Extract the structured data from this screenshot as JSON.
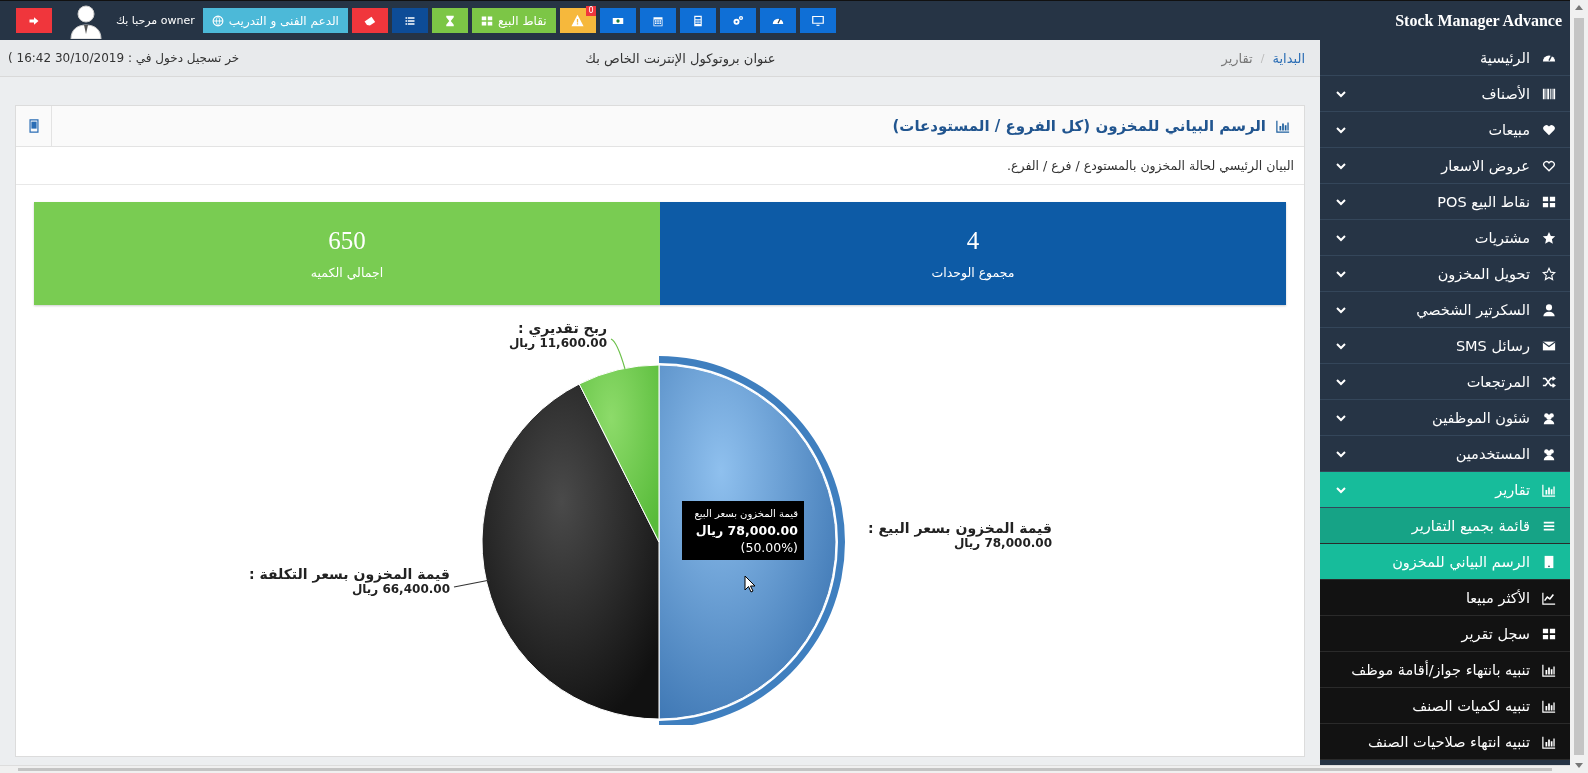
{
  "topbar": {
    "title": "Stock Manager Advance",
    "greeting": "مرحبا بك owner",
    "support_button": "الدعم الفنى و التدريب",
    "pos_button": "نقاط البيع",
    "alerts_badge": "0"
  },
  "breadcrumb_separator": "/",
  "breadcrumb": [
    {
      "label": "البداية",
      "kind": "link"
    },
    {
      "label": "تقارير",
      "kind": "current"
    }
  ],
  "ip_label": "عنوان بروتوكول الإنترنت الخاص بك",
  "last_login": "خر تسجيل دخول في : 30/10/2019 16:42 )",
  "panel": {
    "title": "الرسم البياني للمخزون (كل الفروع / المستودعات)",
    "subtitle": "البيان الرئيسي لحالة المخزون بالمستودع / فرع / الفرع.",
    "stats": [
      {
        "value": "4",
        "label": "مجموع الوحدات",
        "color": "#0d5ba6"
      },
      {
        "value": "650",
        "label": "اجمالي الكميه",
        "color": "#79cc52"
      }
    ],
    "chart_data": {
      "type": "pie",
      "categories": [
        "قيمة المخزون بسعر البيع",
        "قيمة المخزون بسعر التكلفة",
        "ربح تقديري"
      ],
      "series": [
        {
          "values": [
            50,
            42.56,
            7.44
          ]
        }
      ]
    },
    "chart_label_separator": ":",
    "slice_value_texts": [
      "78,000.00 ريال",
      "66,400.00 ريال",
      "11,600.00 ريال"
    ],
    "tooltip": {
      "title": "قيمة المخزون بسعر البيع",
      "value": "78,000.00 ريال",
      "percent": "(50.00%)"
    }
  },
  "sidebar": {
    "items": [
      {
        "label": "الرئيسية",
        "kind": "link",
        "selected": false
      },
      {
        "label": "الأصناف",
        "kind": "menu",
        "selected": false
      },
      {
        "label": "مبيعات",
        "kind": "menu",
        "selected": false
      },
      {
        "label": "عروض الاسعار",
        "kind": "menu",
        "selected": false
      },
      {
        "label": "نقاط البيع POS",
        "kind": "menu",
        "selected": false
      },
      {
        "label": "مشتريات",
        "kind": "menu",
        "selected": false
      },
      {
        "label": "تحويل المخزون",
        "kind": "menu",
        "selected": false
      },
      {
        "label": "السكرتير الشخصي",
        "kind": "menu",
        "selected": false
      },
      {
        "label": "رسائل SMS",
        "kind": "menu",
        "selected": false
      },
      {
        "label": "المرتجعات",
        "kind": "menu",
        "selected": false
      },
      {
        "label": "شئون الموظفين",
        "kind": "menu",
        "selected": false
      },
      {
        "label": "المستخدمين",
        "kind": "menu",
        "selected": false
      },
      {
        "label": "تقارير",
        "kind": "menu",
        "selected": true,
        "children": [
          {
            "label": "قائمة بجميع التقارير",
            "selected": false,
            "hovered": true
          },
          {
            "label": "الرسم البياني للمخزون",
            "selected": true,
            "hovered": false
          },
          {
            "label": "الأكثر مبيعا",
            "selected": false,
            "hovered": false
          },
          {
            "label": "سجل تقرير",
            "selected": false,
            "hovered": false
          },
          {
            "label": "تنبيه بانتهاء جواز/أقامة موظف",
            "selected": false,
            "hovered": false
          },
          {
            "label": "تنبيه لكميات الصنف",
            "selected": false,
            "hovered": false
          },
          {
            "label": "تنبيه انتهاء صلاحيات الصنف",
            "selected": false,
            "hovered": false
          }
        ]
      }
    ]
  }
}
